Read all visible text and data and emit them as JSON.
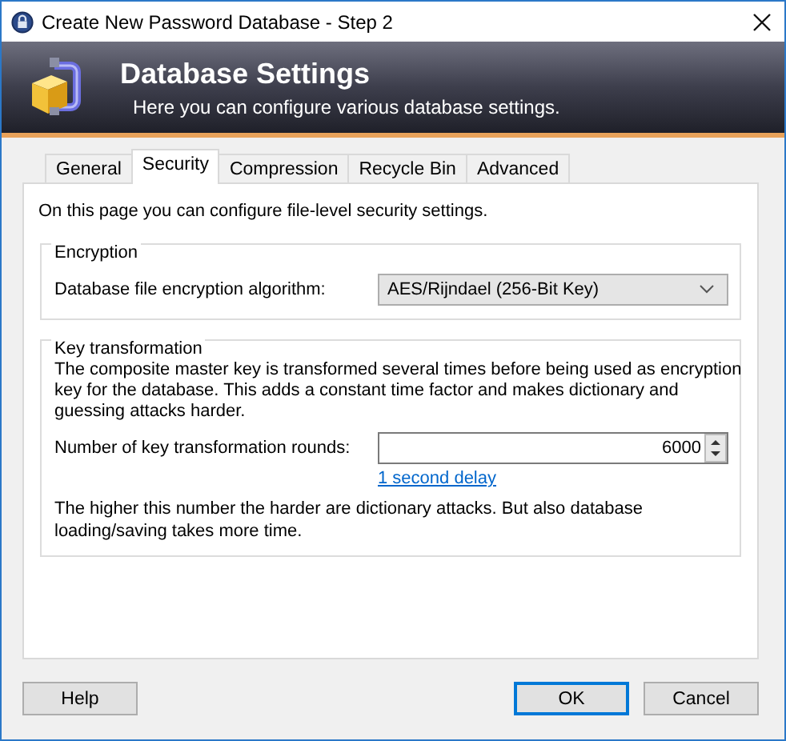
{
  "window": {
    "title": "Create New Password Database - Step 2"
  },
  "banner": {
    "title": "Database Settings",
    "subtitle": "Here you can configure various database settings."
  },
  "tabs": [
    {
      "label": "General",
      "selected": false
    },
    {
      "label": "Security",
      "selected": true
    },
    {
      "label": "Compression",
      "selected": false
    },
    {
      "label": "Recycle Bin",
      "selected": false
    },
    {
      "label": "Advanced",
      "selected": false
    }
  ],
  "page_intro": "On this page you can configure file-level security settings.",
  "encryption": {
    "legend": "Encryption",
    "label": "Database file encryption algorithm:",
    "value": "AES/Rijndael (256-Bit Key)"
  },
  "key_transformation": {
    "legend": "Key transformation",
    "description": "The composite master key is transformed several times before being used as encryption key for the database. This adds a constant time factor and makes dictionary and guessing attacks harder.",
    "rounds_label": "Number of key transformation rounds:",
    "rounds_value": "6000",
    "delay_link": "1 second delay",
    "note": "The higher this number the harder are dictionary attacks. But also database loading/saving takes more time."
  },
  "buttons": [
    {
      "label": "Help",
      "default": false
    },
    {
      "label": "OK",
      "default": true
    },
    {
      "label": "Cancel",
      "default": false
    }
  ]
}
